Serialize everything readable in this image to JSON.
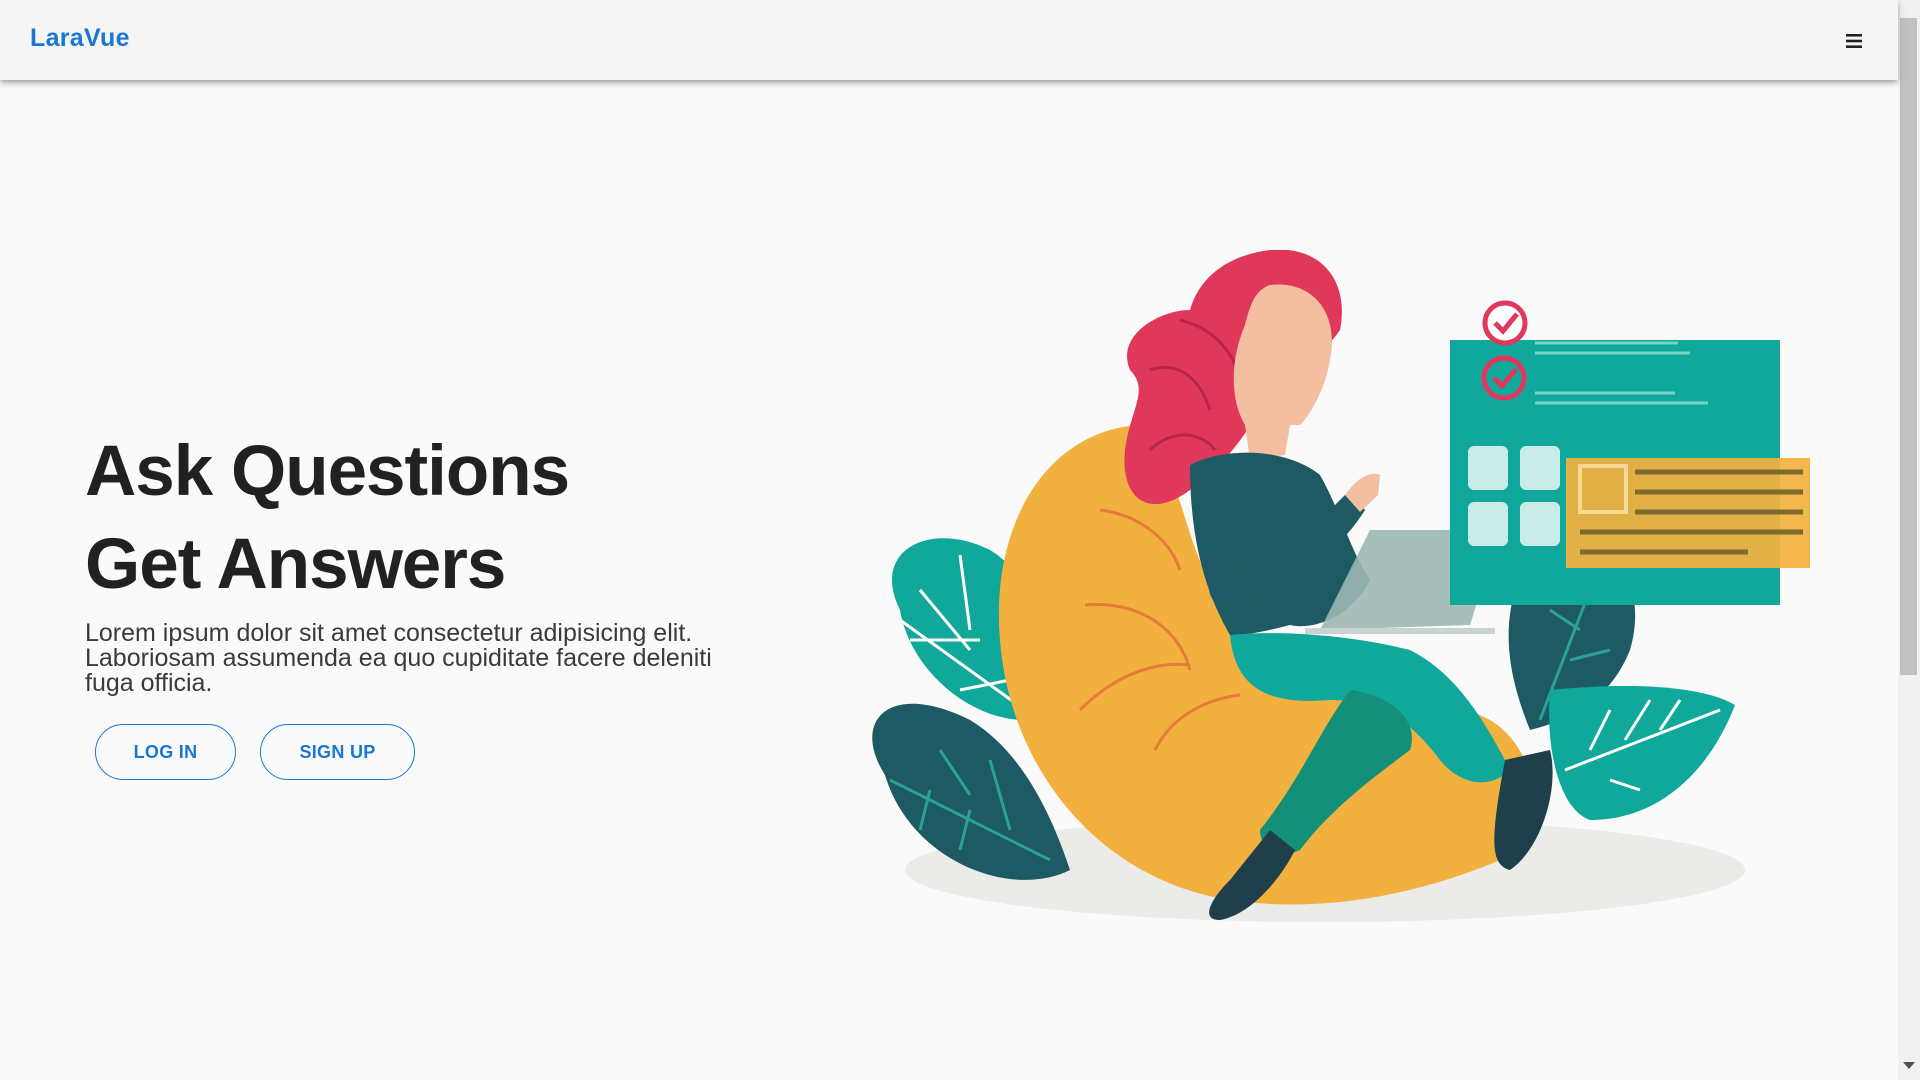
{
  "app": {
    "title": "LaraVue"
  },
  "menu": {
    "icon": "menu-icon"
  },
  "hero": {
    "line1": "Ask Questions",
    "line2": "Get Answers",
    "description": "Lorem ipsum dolor sit amet consectetur adipisicing elit. Laboriosam assumenda ea quo cupiditate facere deleniti fuga officia.",
    "login_label": "LOG IN",
    "signup_label": "SIGN UP"
  },
  "colors": {
    "primary": "#1976d2",
    "teal": "#0fa89a",
    "dark_teal": "#1d5a63",
    "mustard": "#f2b13f",
    "pink": "#e0385b"
  }
}
